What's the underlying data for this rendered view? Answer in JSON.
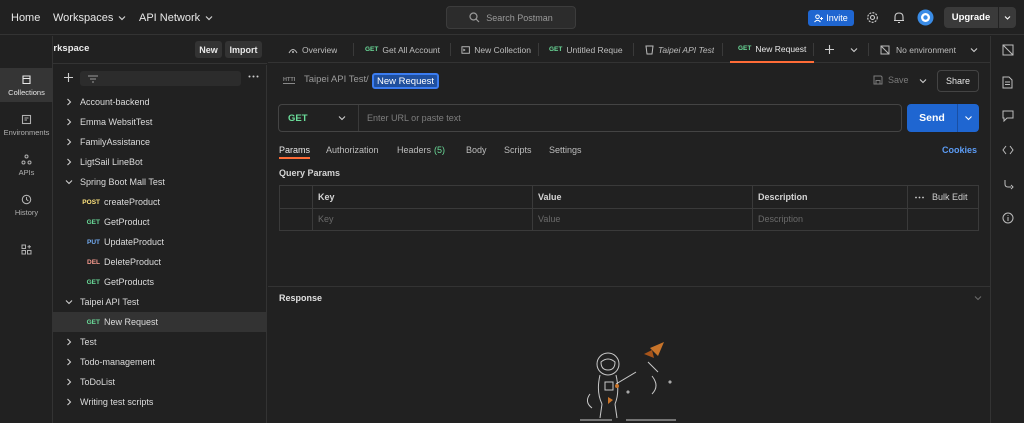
{
  "topbar": {
    "home": "Home",
    "workspaces": "Workspaces",
    "api_network": "API Network",
    "search_placeholder": "Search Postman",
    "invite": "Invite",
    "upgrade": "Upgrade"
  },
  "workspace": {
    "title": "My Workspace",
    "new_label": "New",
    "import_label": "Import"
  },
  "rail": [
    {
      "label": "Collections",
      "icon": "collections-icon",
      "active": true
    },
    {
      "label": "Environments",
      "icon": "environments-icon",
      "active": false
    },
    {
      "label": "APIs",
      "icon": "apis-icon",
      "active": false
    },
    {
      "label": "History",
      "icon": "history-icon",
      "active": false
    },
    {
      "label": "",
      "icon": "add-workbench-icon",
      "active": false
    }
  ],
  "tree": [
    {
      "label": "Account-backend",
      "level": 0,
      "method": ""
    },
    {
      "label": "Emma WebsitTest",
      "level": 0,
      "method": ""
    },
    {
      "label": "FamilyAssistance",
      "level": 0,
      "method": ""
    },
    {
      "label": "LigtSail LineBot",
      "level": 0,
      "method": ""
    },
    {
      "label": "Spring Boot Mall Test",
      "level": 0,
      "method": "",
      "expanded": true
    },
    {
      "label": "createProduct",
      "level": 1,
      "method": "POST"
    },
    {
      "label": "GetProduct",
      "level": 1,
      "method": "GET"
    },
    {
      "label": "UpdateProduct",
      "level": 1,
      "method": "PUT"
    },
    {
      "label": "DeleteProduct",
      "level": 1,
      "method": "DEL"
    },
    {
      "label": "GetProducts",
      "level": 1,
      "method": "GET"
    },
    {
      "label": "Taipei API Test",
      "level": 0,
      "method": "",
      "expanded": true
    },
    {
      "label": "New Request",
      "level": 1,
      "method": "GET",
      "selected": true
    },
    {
      "label": "Test",
      "level": 0,
      "method": ""
    },
    {
      "label": "Todo-management",
      "level": 0,
      "method": ""
    },
    {
      "label": "ToDoList",
      "level": 0,
      "method": ""
    },
    {
      "label": "Writing test scripts",
      "level": 0,
      "method": ""
    }
  ],
  "tabs": {
    "overview": "Overview",
    "items": [
      {
        "method": "GET",
        "label": "Get All Account"
      },
      {
        "method": "",
        "label": "New Collection"
      },
      {
        "method": "GET",
        "label": "Untitled Reques"
      },
      {
        "method": "",
        "label": "Taipei API Test"
      },
      {
        "method": "GET",
        "label": "New Request"
      }
    ],
    "environment": "No environment"
  },
  "request": {
    "crumb_parent": "Taipei API Test",
    "crumb_sep": "/",
    "name": "New Request",
    "save": "Save",
    "share": "Share",
    "method": "GET",
    "url_placeholder": "Enter URL or paste text",
    "send": "Send"
  },
  "subtabs": {
    "params": "Params",
    "authorization": "Authorization",
    "headers": "Headers",
    "headers_count": "(5)",
    "body": "Body",
    "scripts": "Scripts",
    "settings": "Settings",
    "cookies": "Cookies"
  },
  "params": {
    "title": "Query Params",
    "col_key": "Key",
    "col_value": "Value",
    "col_description": "Description",
    "bulk_edit": "Bulk Edit",
    "ph_key": "Key",
    "ph_value": "Value",
    "ph_description": "Description"
  },
  "response": {
    "title": "Response"
  },
  "colors": {
    "accent": "#ff6c37",
    "primary": "#1f66d1",
    "get": "#6bdd9a",
    "post": "#ffe47e",
    "put": "#74aef6",
    "delete": "#f79a8e"
  }
}
